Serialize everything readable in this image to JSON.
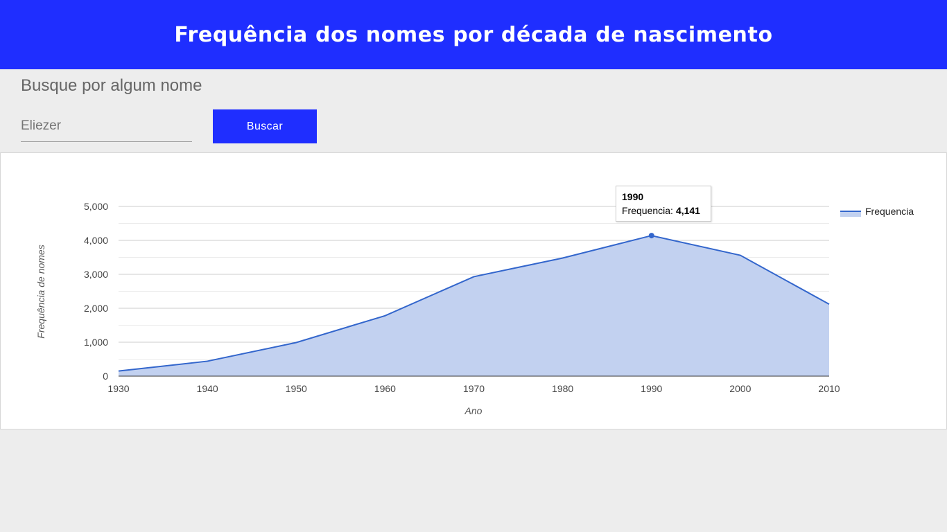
{
  "header": {
    "title": "Frequência dos nomes por década de nascimento"
  },
  "search": {
    "title": "Busque por algum nome",
    "value": "Eliezer",
    "button_label": "Buscar"
  },
  "colors": {
    "brand": "#1f2eff",
    "series_line": "#3366cc",
    "series_fill": "#c2d1f0"
  },
  "chart_data": {
    "type": "area",
    "xlabel": "Ano",
    "ylabel": "Frequência de nomes",
    "x": [
      "1930",
      "1940",
      "1950",
      "1960",
      "1970",
      "1980",
      "1990",
      "2000",
      "2010"
    ],
    "series": [
      {
        "name": "Frequencia",
        "values": [
          150,
          440,
          990,
          1780,
          2930,
          3480,
          4141,
          3560,
          2120
        ]
      }
    ],
    "yticks": [
      "0",
      "1,000",
      "2,000",
      "3,000",
      "4,000",
      "5,000"
    ],
    "ylim": [
      0,
      5000
    ],
    "grid": true,
    "legend": "right",
    "tooltip": {
      "title": "1990",
      "series": "Frequencia:",
      "value": "4,141"
    }
  }
}
